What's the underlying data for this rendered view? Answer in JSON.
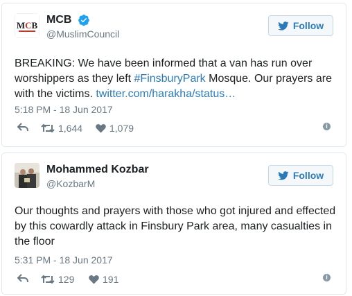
{
  "tweets": [
    {
      "display_name": "MCB",
      "handle": "@MuslimCouncil",
      "verified": true,
      "follow_label": "Follow",
      "text_before": "BREAKING: We have been informed that a van has run over worshippers as they left ",
      "hashtag": "#FinsburyPark",
      "text_after": " Mosque. Our prayers are with the victims. ",
      "link": "twitter.com/harakha/status…",
      "timestamp": "5:18 PM - 18 Jun 2017",
      "retweets": "1,644",
      "likes": "1,079",
      "avatar_text": "MCB"
    },
    {
      "display_name": "Mohammed Kozbar",
      "handle": "@KozbarM",
      "verified": false,
      "follow_label": "Follow",
      "text": "Our thoughts and prayers with those who got injured and effected by this cowardly attack in Finsbury Park area, many casualties in the floor",
      "timestamp": "5:31 PM - 18 Jun 2017",
      "retweets": "129",
      "likes": "191"
    }
  ],
  "colors": {
    "link": "#2b7bb9",
    "muted": "#697882",
    "text": "#1c2022",
    "verified": "#1da1f2"
  },
  "icons": [
    "reply-icon",
    "retweet-icon",
    "heart-icon",
    "info-icon",
    "twitter-bird-icon",
    "verified-badge-icon"
  ]
}
